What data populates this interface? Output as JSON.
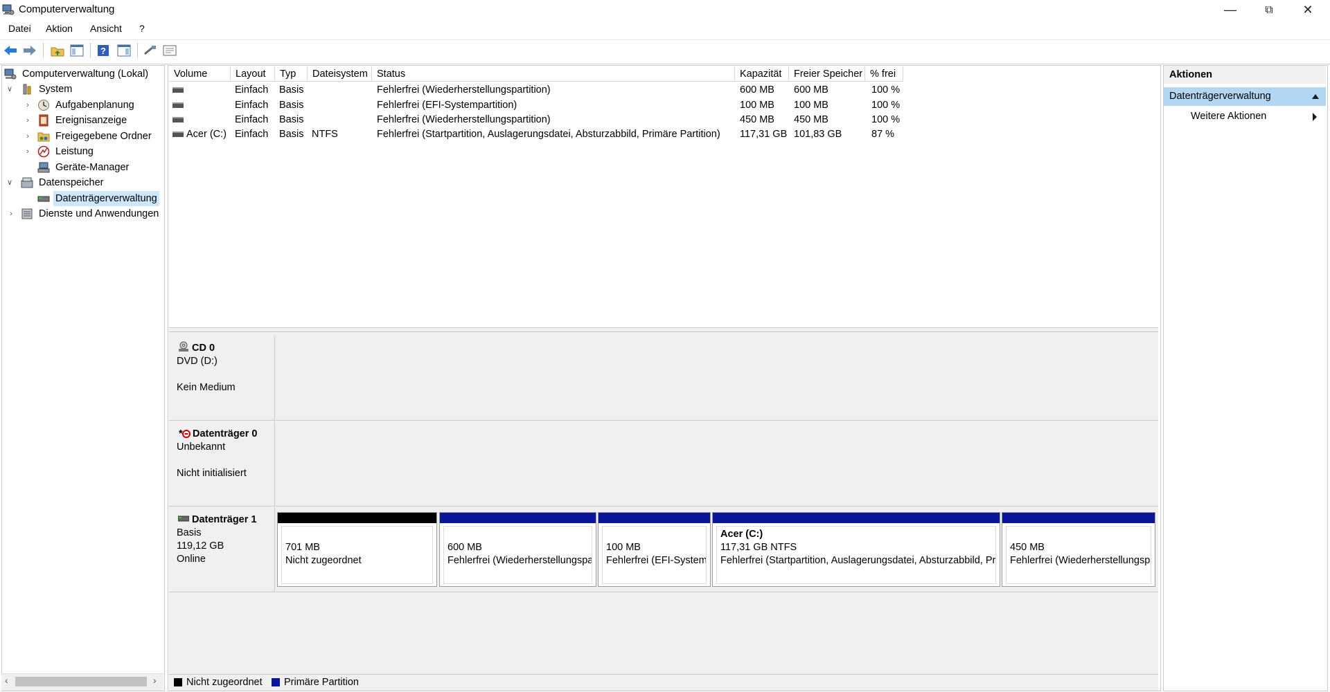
{
  "window": {
    "title": "Computerverwaltung",
    "minimize_icon": "minimize-icon",
    "restore_icon": "restore-icon",
    "close_icon": "close-icon"
  },
  "menu": [
    "Datei",
    "Aktion",
    "Ansicht",
    "?"
  ],
  "toolbar_icons": [
    "back-arrow-icon",
    "forward-arrow-icon",
    "folder-up-icon",
    "show-hide-tree-icon",
    "help-icon",
    "show-hide-action-pane-icon",
    "connect-icon",
    "properties-icon"
  ],
  "tree": {
    "root": "Computerverwaltung (Lokal)",
    "system": "System",
    "aufgabenplanung": "Aufgabenplanung",
    "ereignisanzeige": "Ereignisanzeige",
    "freigegebene_ordner": "Freigegebene Ordner",
    "leistung": "Leistung",
    "geraete_manager": "Geräte-Manager",
    "datenspeicher": "Datenspeicher",
    "datentraegerverwaltung": "Datenträgerverwaltung",
    "dienste": "Dienste und Anwendungen"
  },
  "columns": [
    "Volume",
    "Layout",
    "Typ",
    "Dateisystem",
    "Status",
    "Kapazität",
    "Freier Speicher",
    "% frei"
  ],
  "volumes": [
    {
      "volume": "",
      "layout": "Einfach",
      "typ": "Basis",
      "dateisystem": "",
      "status": "Fehlerfrei (Wiederherstellungspartition)",
      "kapazitaet": "600 MB",
      "frei": "600 MB",
      "prozent": "100 %"
    },
    {
      "volume": "",
      "layout": "Einfach",
      "typ": "Basis",
      "dateisystem": "",
      "status": "Fehlerfrei (EFI-Systempartition)",
      "kapazitaet": "100 MB",
      "frei": "100 MB",
      "prozent": "100 %"
    },
    {
      "volume": "",
      "layout": "Einfach",
      "typ": "Basis",
      "dateisystem": "",
      "status": "Fehlerfrei (Wiederherstellungspartition)",
      "kapazitaet": "450 MB",
      "frei": "450 MB",
      "prozent": "100 %"
    },
    {
      "volume": "Acer (C:)",
      "layout": "Einfach",
      "typ": "Basis",
      "dateisystem": "NTFS",
      "status": "Fehlerfrei (Startpartition, Auslagerungsdatei, Absturzabbild, Primäre Partition)",
      "kapazitaet": "117,31 GB",
      "frei": "101,83 GB",
      "prozent": "87 %"
    }
  ],
  "disks": {
    "cd0": {
      "name": "CD 0",
      "type": "DVD (D:)",
      "state": "Kein Medium"
    },
    "disk0": {
      "prefix": "*",
      "name": "Datenträger 0",
      "type": "Unbekannt",
      "state": "Nicht initialisiert"
    },
    "disk1": {
      "name": "Datenträger 1",
      "type": "Basis",
      "size": "119,12 GB",
      "state": "Online",
      "partitions": [
        {
          "title": "",
          "size": "701 MB",
          "desc": "Nicht zugeordnet",
          "color": "#000000"
        },
        {
          "title": "",
          "size": "600 MB",
          "desc": "Fehlerfrei (Wiederherstellungspartition)",
          "color": "#0a1599"
        },
        {
          "title": "",
          "size": "100 MB",
          "desc": "Fehlerfrei (EFI-Systempartition)",
          "color": "#0a1599"
        },
        {
          "title": "Acer  (C:)",
          "size": "117,31 GB NTFS",
          "desc": "Fehlerfrei (Startpartition, Auslagerungsdatei, Absturzabbild, Primäre Partition)",
          "color": "#0a1599"
        },
        {
          "title": "",
          "size": "450 MB",
          "desc": "Fehlerfrei (Wiederherstellungspartition)",
          "color": "#0a1599"
        }
      ]
    }
  },
  "legend": {
    "unallocated": "Nicht zugeordnet",
    "unallocated_color": "#000000",
    "primary": "Primäre Partition",
    "primary_color": "#0a1599"
  },
  "actions": {
    "header": "Aktionen",
    "section": "Datenträgerverwaltung",
    "more": "Weitere Aktionen"
  }
}
